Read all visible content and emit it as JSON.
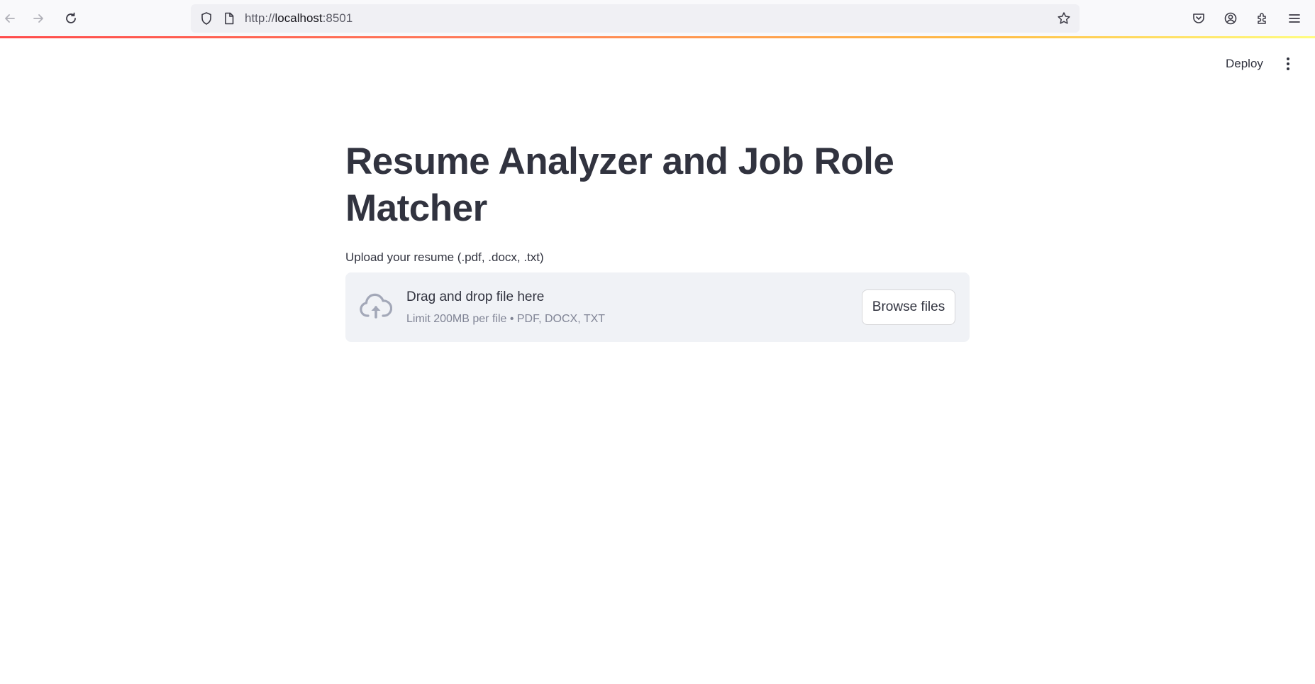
{
  "browser": {
    "url_scheme": "http://",
    "url_host": "localhost",
    "url_port": ":8501",
    "icons": [
      "back-icon",
      "forward-icon",
      "reload-icon",
      "shield-icon",
      "page-icon",
      "star-icon",
      "pocket-icon",
      "account-icon",
      "extensions-icon",
      "menu-icon"
    ]
  },
  "header": {
    "deploy_label": "Deploy",
    "menu_icon": "kebab-menu-icon"
  },
  "main": {
    "title": "Resume Analyzer and Job Role Matcher",
    "uploader": {
      "label": "Upload your resume (.pdf, .docx, .txt)",
      "drop_title": "Drag and drop file here",
      "limit_text": "Limit 200MB per file • PDF, DOCX, TXT",
      "browse_label": "Browse files",
      "icon": "cloud-upload-icon"
    }
  },
  "colors": {
    "accent_gradient": [
      "#ff4b4b",
      "#ffbd45",
      "#fffd80"
    ],
    "text": "#31333f",
    "dropzone_bg": "#f0f2f6",
    "muted_text": "#808495"
  }
}
